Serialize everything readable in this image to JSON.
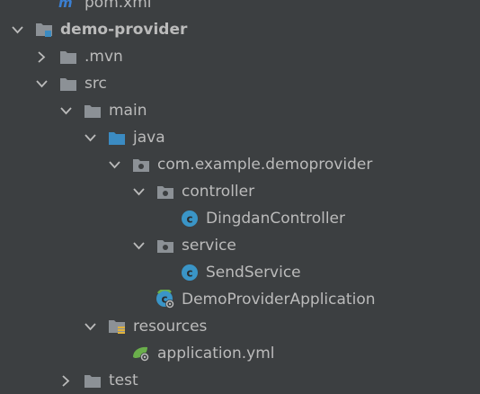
{
  "tree": {
    "items": [
      {
        "label": "pom.xml",
        "depth": 2,
        "icon": "maven-icon",
        "arrow": "none"
      },
      {
        "label": "demo-provider",
        "depth": 1,
        "icon": "module-folder-icon",
        "arrow": "down",
        "bold": true
      },
      {
        "label": ".mvn",
        "depth": 2,
        "icon": "folder-icon",
        "arrow": "right"
      },
      {
        "label": "src",
        "depth": 2,
        "icon": "folder-icon",
        "arrow": "down"
      },
      {
        "label": "main",
        "depth": 3,
        "icon": "folder-icon",
        "arrow": "down"
      },
      {
        "label": "java",
        "depth": 4,
        "icon": "source-folder-icon",
        "arrow": "down"
      },
      {
        "label": "com.example.demoprovider",
        "depth": 5,
        "icon": "package-icon",
        "arrow": "down"
      },
      {
        "label": "controller",
        "depth": 6,
        "icon": "package-icon",
        "arrow": "down"
      },
      {
        "label": "DingdanController",
        "depth": 7,
        "icon": "class-icon",
        "arrow": "none"
      },
      {
        "label": "service",
        "depth": 6,
        "icon": "package-icon",
        "arrow": "down"
      },
      {
        "label": "SendService",
        "depth": 7,
        "icon": "class-icon",
        "arrow": "none"
      },
      {
        "label": "DemoProviderApplication",
        "depth": 6,
        "icon": "spring-boot-class-icon",
        "arrow": "none"
      },
      {
        "label": "resources",
        "depth": 4,
        "icon": "resources-folder-icon",
        "arrow": "down"
      },
      {
        "label": "application.yml",
        "depth": 5,
        "icon": "spring-config-icon",
        "arrow": "none"
      },
      {
        "label": "test",
        "depth": 3,
        "icon": "folder-icon",
        "arrow": "right"
      }
    ]
  },
  "colors": {
    "background": "#3c3f41",
    "text": "#bbbbbb",
    "folder": "#8c9196",
    "source_folder": "#3b8bc2",
    "class_icon": "#3a95c7",
    "spring_green": "#6aaf4b",
    "resources_stripe": "#e0b23c",
    "maven_blue": "#3b7fd1"
  }
}
